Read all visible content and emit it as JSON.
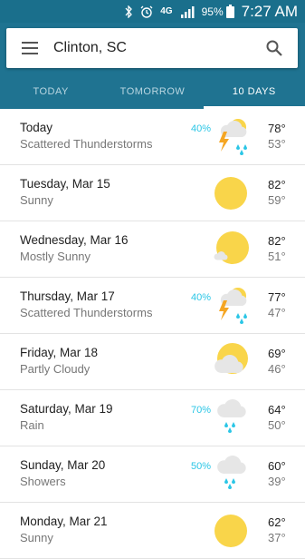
{
  "status_bar": {
    "network": "4G",
    "battery": "95%",
    "time": "7:27 AM"
  },
  "search": {
    "location": "Clinton, SC"
  },
  "tabs": [
    {
      "label": "TODAY"
    },
    {
      "label": "TOMORROW"
    },
    {
      "label": "10 DAYS"
    }
  ],
  "active_tab": "10 DAYS",
  "colors": {
    "header": "#1f7391",
    "status": "#1a6f8c",
    "precip": "#2bc6e6",
    "sun": "#f9d54a",
    "cloud": "#e6e6e6",
    "bolt": "#f5a623"
  },
  "forecast": [
    {
      "day": "Today",
      "condition": "Scattered Thunderstorms",
      "precip": "40%",
      "icon": "thunderstorm-icon",
      "high": "78°",
      "low": "53°"
    },
    {
      "day": "Tuesday, Mar 15",
      "condition": "Sunny",
      "precip": "",
      "icon": "sun-icon",
      "high": "82°",
      "low": "59°"
    },
    {
      "day": "Wednesday, Mar 16",
      "condition": "Mostly Sunny",
      "precip": "",
      "icon": "mostly-sunny-icon",
      "high": "82°",
      "low": "51°"
    },
    {
      "day": "Thursday, Mar 17",
      "condition": "Scattered Thunderstorms",
      "precip": "40%",
      "icon": "thunderstorm-icon",
      "high": "77°",
      "low": "47°"
    },
    {
      "day": "Friday, Mar 18",
      "condition": "Partly Cloudy",
      "precip": "",
      "icon": "partly-cloudy-icon",
      "high": "69°",
      "low": "46°"
    },
    {
      "day": "Saturday, Mar 19",
      "condition": "Rain",
      "precip": "70%",
      "icon": "rain-icon",
      "high": "64°",
      "low": "50°"
    },
    {
      "day": "Sunday, Mar 20",
      "condition": "Showers",
      "precip": "50%",
      "icon": "showers-icon",
      "high": "60°",
      "low": "39°"
    },
    {
      "day": "Monday, Mar 21",
      "condition": "Sunny",
      "precip": "",
      "icon": "sun-icon",
      "high": "62°",
      "low": "37°"
    }
  ]
}
